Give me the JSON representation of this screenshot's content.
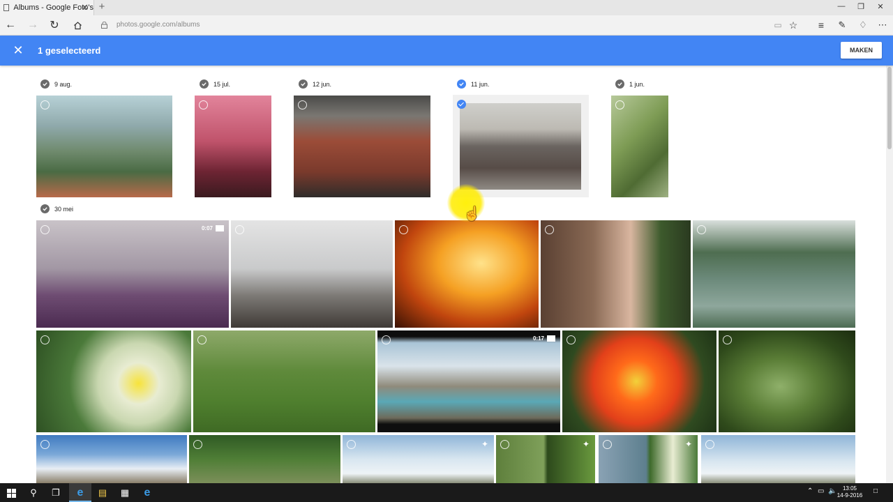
{
  "browser": {
    "tab_title": "Albums - Google Foto's",
    "tab_close": "✕",
    "new_tab": "+",
    "url": "photos.google.com/albums"
  },
  "header": {
    "selection_text": "1 geselecteerd",
    "make_button": "MAKEN"
  },
  "dates": [
    "9 aug.",
    "15 jul.",
    "12 jun.",
    "11 jun.",
    "1 jun.",
    "30 mei"
  ],
  "videos": [
    {
      "duration": "0:07"
    },
    {
      "duration": "0:17"
    }
  ],
  "taskbar": {
    "time": "13:05",
    "date": "14-9-2016"
  },
  "colors": {
    "accent": "#4285f4",
    "selected_check": "#4285f4",
    "unselected_check": "#6a6a6a"
  }
}
